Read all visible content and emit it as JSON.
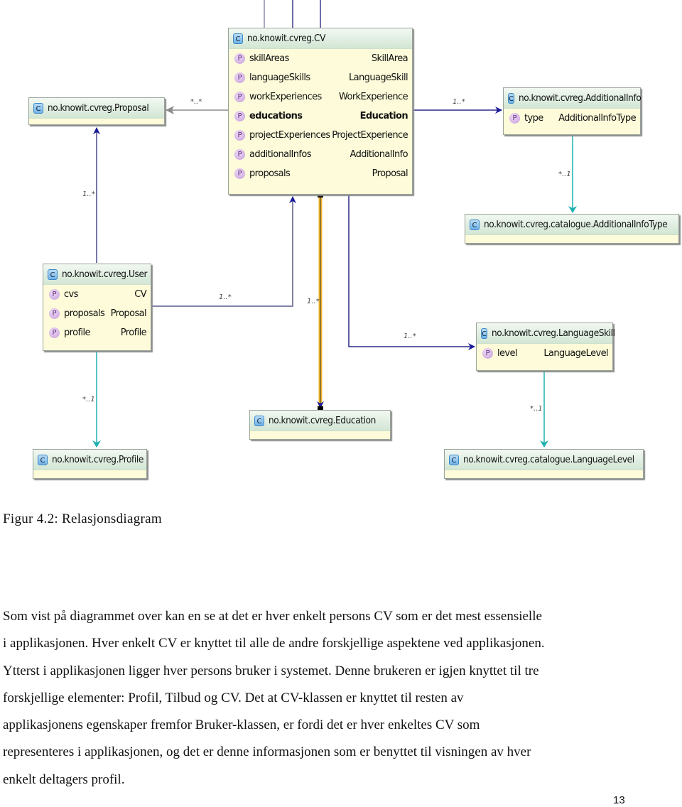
{
  "diagram": {
    "classes": {
      "cv": {
        "name": "no.knowit.cvreg.CV",
        "properties": [
          {
            "name": "skillAreas",
            "type": "SkillArea",
            "bold": false
          },
          {
            "name": "languageSkills",
            "type": "LanguageSkill",
            "bold": false
          },
          {
            "name": "workExperiences",
            "type": "WorkExperience",
            "bold": false
          },
          {
            "name": "educations",
            "type": "Education",
            "bold": true
          },
          {
            "name": "projectExperiences",
            "type": "ProjectExperience",
            "bold": false
          },
          {
            "name": "additionalInfos",
            "type": "AdditionalInfo",
            "bold": false
          },
          {
            "name": "proposals",
            "type": "Proposal",
            "bold": false
          }
        ]
      },
      "proposal": {
        "name": "no.knowit.cvreg.Proposal",
        "properties": []
      },
      "additional_info": {
        "name": "no.knowit.cvreg.AdditionalInfo",
        "properties": [
          {
            "name": "type",
            "type": "AdditionalInfoType",
            "bold": false
          }
        ]
      },
      "additional_info_type": {
        "name": "no.knowit.cvreg.catalogue.AdditionalInfoType",
        "properties": []
      },
      "user": {
        "name": "no.knowit.cvreg.User",
        "properties": [
          {
            "name": "cvs",
            "type": "CV",
            "bold": false
          },
          {
            "name": "proposals",
            "type": "Proposal",
            "bold": false
          },
          {
            "name": "profile",
            "type": "Profile",
            "bold": false
          }
        ]
      },
      "language_skill": {
        "name": "no.knowit.cvreg.LanguageSkill",
        "properties": [
          {
            "name": "level",
            "type": "LanguageLevel",
            "bold": false
          }
        ]
      },
      "education": {
        "name": "no.knowit.cvreg.Education",
        "properties": []
      },
      "profile": {
        "name": "no.knowit.cvreg.Profile",
        "properties": []
      },
      "language_level": {
        "name": "no.knowit.cvreg.catalogue.LanguageLevel",
        "properties": []
      }
    },
    "class_icon": "C",
    "property_icon": "P",
    "multiplicities": {
      "cv_to_proposal": "*..*",
      "user_to_proposal": "1..*",
      "cv_to_additional_info": "1..*",
      "additional_info_to_type": "*..1",
      "user_to_cv": "1..*",
      "cv_to_education": "1..*",
      "cv_to_language_skill": "1..*",
      "user_to_profile": "*..1",
      "language_skill_to_level": "*..1"
    },
    "colors": {
      "navy_edge": "#2a2a8a",
      "gray_edge": "#8c8c8c",
      "teal_edge": "#1fb0b0",
      "highlight_edge": "#f0b429"
    }
  },
  "caption": "Figur 4.2: Relasjonsdiagram",
  "body_lines": [
    "Som vist på diagrammet over kan en se at det er hver enkelt persons CV som er det mest essensielle",
    "i applikasjonen. Hver enkelt CV er knyttet til alle de andre forskjellige aspektene ved applikasjonen.",
    "Ytterst i applikasjonen ligger hver persons bruker i systemet. Denne brukeren er igjen knyttet til tre",
    "forskjellige elementer: Profil, Tilbud og CV. Det at CV-klassen er knyttet til resten av",
    "applikasjonens egenskaper fremfor Bruker-klassen, er fordi det er hver enkeltes CV som",
    "representeres i applikasjonen, og det er denne informasjonen som er benyttet til visningen av hver",
    "enkelt deltagers profil."
  ],
  "page_number": "13"
}
